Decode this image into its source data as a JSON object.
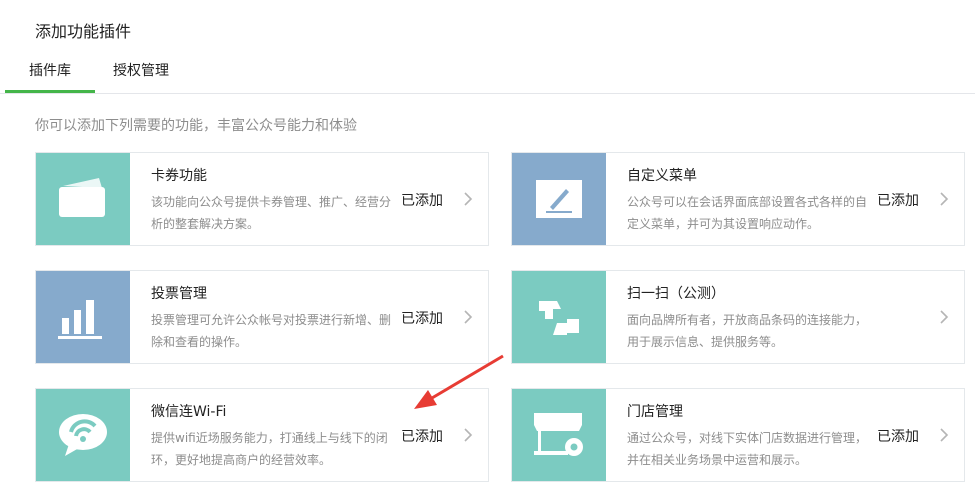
{
  "header": {
    "title": "添加功能插件"
  },
  "tabs": [
    {
      "label": "插件库"
    },
    {
      "label": "授权管理"
    }
  ],
  "intro": "你可以添加下列需要的功能，丰富公众号能力和体验",
  "colors": {
    "teal": "#7bcbc1",
    "blue": "#86aacc",
    "accent_green": "#44b549",
    "annotation_red": "#e73c34"
  },
  "plugins": [
    {
      "title": "卡券功能",
      "desc": "该功能向公众号提供卡券管理、推广、经营分析的整套解决方案。",
      "status": "已添加",
      "icon": "card-icon"
    },
    {
      "title": "自定义菜单",
      "desc": "公众号可以在会话界面底部设置各式各样的自定义菜单，并可为其设置响应动作。",
      "status": "已添加",
      "icon": "pencil-icon"
    },
    {
      "title": "投票管理",
      "desc": "投票管理可允许公众帐号对投票进行新增、删除和查看的操作。",
      "status": "已添加",
      "icon": "bar-chart-icon"
    },
    {
      "title": "扫一扫（公测）",
      "desc": "面向品牌所有者，开放商品条码的连接能力，用于展示信息、提供服务等。",
      "status": "",
      "icon": "scan-icon"
    },
    {
      "title": "微信连Wi-Fi",
      "desc": "提供wifi近场服务能力，打通线上与线下的闭环，更好地提高商户的经营效率。",
      "status": "已添加",
      "icon": "wifi-chat-icon"
    },
    {
      "title": "门店管理",
      "desc": "通过公众号，对线下实体门店数据进行管理，并在相关业务场景中运营和展示。",
      "status": "已添加",
      "icon": "store-icon"
    }
  ]
}
